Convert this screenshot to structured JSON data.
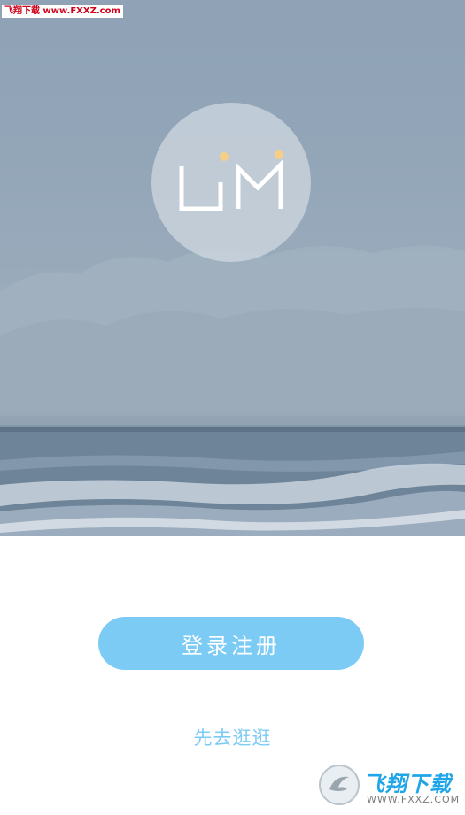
{
  "watermark": {
    "top_text": "飞翔下载 www.FXXZ.com",
    "bottom_brand": "飞翔下载",
    "bottom_url": "WWW.FXXZ.COM"
  },
  "logo": {
    "text": "UM",
    "dot_color": "#f6cf86"
  },
  "actions": {
    "login_register_label": "登录注册",
    "browse_label": "先去逛逛"
  },
  "colors": {
    "accent": "#7ccbf5",
    "background": "#ffffff"
  }
}
